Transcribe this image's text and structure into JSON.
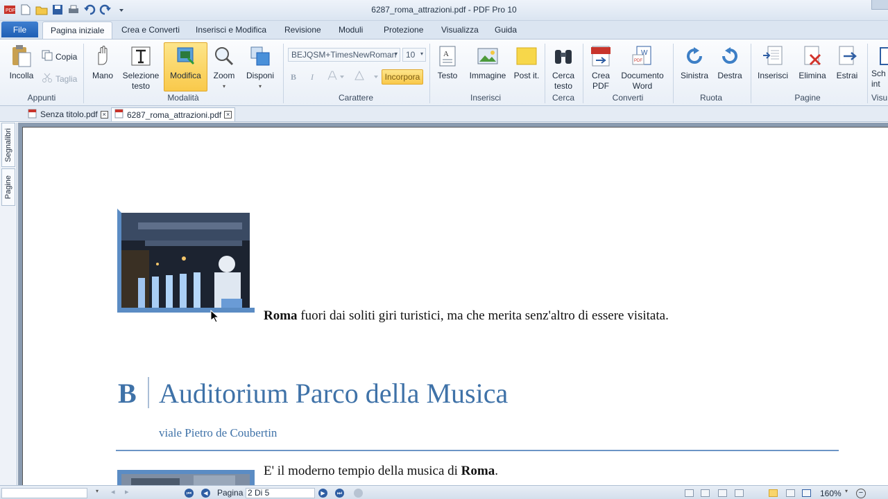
{
  "window": {
    "title": "6287_roma_attrazioni.pdf - PDF Pro 10"
  },
  "quick_access": [
    "app-logo-icon",
    "new-icon",
    "open-icon",
    "save-icon",
    "print-icon",
    "undo-icon",
    "redo-icon",
    "customize-icon"
  ],
  "ribbon_tabs": {
    "file": "File",
    "items": [
      "Pagina iniziale",
      "Crea e Converti",
      "Inserisci e Modifica",
      "Revisione",
      "Moduli",
      "Protezione",
      "Visualizza",
      "Guida"
    ],
    "active": "Pagina iniziale"
  },
  "ribbon": {
    "appunti": {
      "label": "Appunti",
      "incolla": "Incolla",
      "copia": "Copia",
      "taglia": "Taglia"
    },
    "modalita": {
      "label": "Modalità",
      "mano": "Mano",
      "selezione": "Selezione testo",
      "modifica": "Modifica",
      "zoom": "Zoom",
      "disponi": "Disponi"
    },
    "carattere": {
      "label": "Carattere",
      "font": "BEJQSM+TimesNewRoman",
      "size": "10",
      "incorpora": "Incorpora",
      "bold": "B",
      "italic": "I"
    },
    "inserisci": {
      "label": "Inserisci",
      "testo": "Testo",
      "immagine": "Immagine",
      "postit": "Post it."
    },
    "cerca": {
      "label": "Cerca",
      "cerca_testo": "Cerca testo"
    },
    "converti": {
      "label": "Converti",
      "crea_pdf": "Crea PDF",
      "documento_word": "Documento Word",
      "pdf_badge": "PDF"
    },
    "ruota": {
      "label": "Ruota",
      "sinistra": "Sinistra",
      "destra": "Destra"
    },
    "pagine": {
      "label": "Pagine",
      "inserisci": "Inserisci",
      "elimina": "Elimina",
      "estrai": "Estrai"
    },
    "visualizza_partial": {
      "label": "Visu",
      "sch": "Sch",
      "int": "int"
    }
  },
  "doc_tabs": [
    {
      "name": "Senza titolo.pdf",
      "close": "×"
    },
    {
      "name": "6287_roma_attrazioni.pdf",
      "close": "×"
    }
  ],
  "side_tabs": [
    "Segnalibri",
    "Pagine"
  ],
  "document": {
    "intro_bold": "Roma",
    "intro_rest": " fuori dai soliti giri turistici, ma che merita senz'altro di essere visitata.",
    "section_letter": "B",
    "section_title": "Auditorium Parco della Musica",
    "section_address": "viale Pietro de Coubertin",
    "body_prefix": "E' il moderno tempio della musica di ",
    "body_bold": "Roma",
    "body_suffix": "."
  },
  "statusbar": {
    "page_label": "Pagina",
    "page_value": "2 Di 5",
    "zoom": "160%"
  },
  "colors": {
    "accent_blue": "#3d6fa8",
    "heading_blue": "#3f72a8",
    "highlight_yellow": "#f9c94b"
  }
}
